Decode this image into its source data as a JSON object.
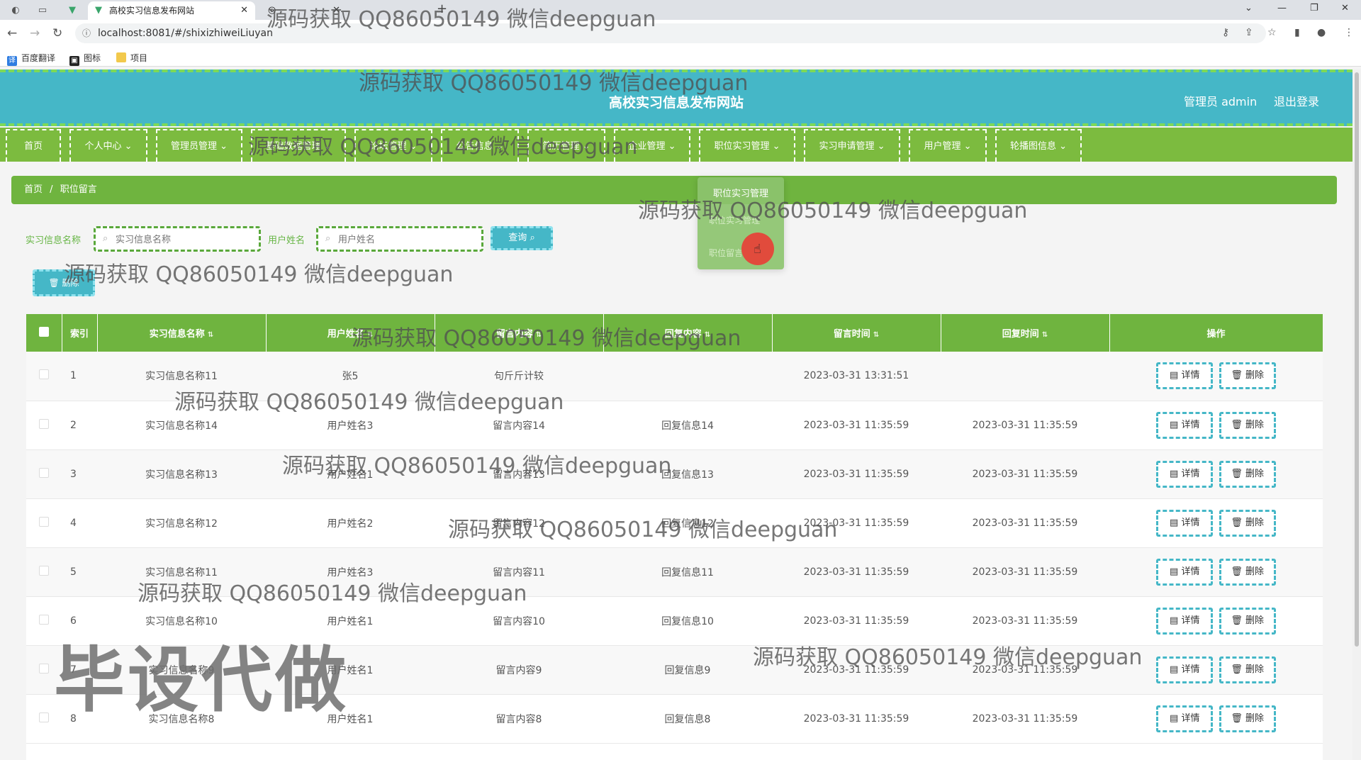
{
  "browser": {
    "tabs": [
      {
        "title": "高校实习信息发布网站",
        "active": true
      },
      {
        "title": "",
        "active": false
      }
    ],
    "url": "localhost:8081/#/shixizhiweiLiuyan",
    "bookmarks": [
      "百度翻译",
      "图标",
      "项目"
    ]
  },
  "header": {
    "site_title": "高校实习信息发布网站",
    "admin_label": "管理员 admin",
    "logout_label": "退出登录"
  },
  "menu": [
    {
      "label": "首页"
    },
    {
      "label": "个人中心"
    },
    {
      "label": "管理员管理"
    },
    {
      "label": "基础数据管理"
    },
    {
      "label": "论坛管理"
    },
    {
      "label": "公告信息"
    },
    {
      "label": "简历管理"
    },
    {
      "label": "企业管理"
    },
    {
      "label": "职位实习管理"
    },
    {
      "label": "实习申请管理"
    },
    {
      "label": "用户管理"
    },
    {
      "label": "轮播图信息"
    }
  ],
  "breadcrumb": {
    "home": "首页",
    "sep": "/",
    "current": "职位留言"
  },
  "dropdown": {
    "header": "职位实习管理",
    "items": [
      "职位实习管理",
      "职位留言"
    ]
  },
  "search": {
    "name_label": "实习信息名称",
    "name_placeholder": "实习信息名称",
    "user_label": "用户姓名",
    "user_placeholder": "用户姓名",
    "search_button": "查询",
    "delete_button": "删除"
  },
  "table": {
    "columns": [
      "索引",
      "实习信息名称",
      "用户姓名",
      "留言内容",
      "回复内容",
      "留言时间",
      "回复时间",
      "操作"
    ],
    "rows": [
      {
        "idx": "1",
        "name": "实习信息名称11",
        "user": "张5",
        "content": "句斤斤计较",
        "reply": "",
        "time": "2023-03-31 13:31:51",
        "reply_time": ""
      },
      {
        "idx": "2",
        "name": "实习信息名称14",
        "user": "用户姓名3",
        "content": "留言内容14",
        "reply": "回复信息14",
        "time": "2023-03-31 11:35:59",
        "reply_time": "2023-03-31 11:35:59"
      },
      {
        "idx": "3",
        "name": "实习信息名称13",
        "user": "用户姓名1",
        "content": "留言内容13",
        "reply": "回复信息13",
        "time": "2023-03-31 11:35:59",
        "reply_time": "2023-03-31 11:35:59"
      },
      {
        "idx": "4",
        "name": "实习信息名称12",
        "user": "用户姓名2",
        "content": "留言内容12",
        "reply": "回复信息12",
        "time": "2023-03-31 11:35:59",
        "reply_time": "2023-03-31 11:35:59"
      },
      {
        "idx": "5",
        "name": "实习信息名称11",
        "user": "用户姓名3",
        "content": "留言内容11",
        "reply": "回复信息11",
        "time": "2023-03-31 11:35:59",
        "reply_time": "2023-03-31 11:35:59"
      },
      {
        "idx": "6",
        "name": "实习信息名称10",
        "user": "用户姓名1",
        "content": "留言内容10",
        "reply": "回复信息10",
        "time": "2023-03-31 11:35:59",
        "reply_time": "2023-03-31 11:35:59"
      },
      {
        "idx": "7",
        "name": "实习信息名称9",
        "user": "用户姓名1",
        "content": "留言内容9",
        "reply": "回复信息9",
        "time": "2023-03-31 11:35:59",
        "reply_time": "2023-03-31 11:35:59"
      },
      {
        "idx": "8",
        "name": "实习信息名称8",
        "user": "用户姓名1",
        "content": "留言内容8",
        "reply": "回复信息8",
        "time": "2023-03-31 11:35:59",
        "reply_time": "2023-03-31 11:35:59"
      }
    ],
    "detail_button": "详情",
    "delete_button": "删除"
  },
  "watermark": {
    "text": "源码获取 QQ86050149 微信deepguan",
    "big": "毕设代做"
  },
  "colors": {
    "header_teal": "#45b7c7",
    "menu_green": "#7cbb3f",
    "table_header_green": "#6fb43f"
  }
}
